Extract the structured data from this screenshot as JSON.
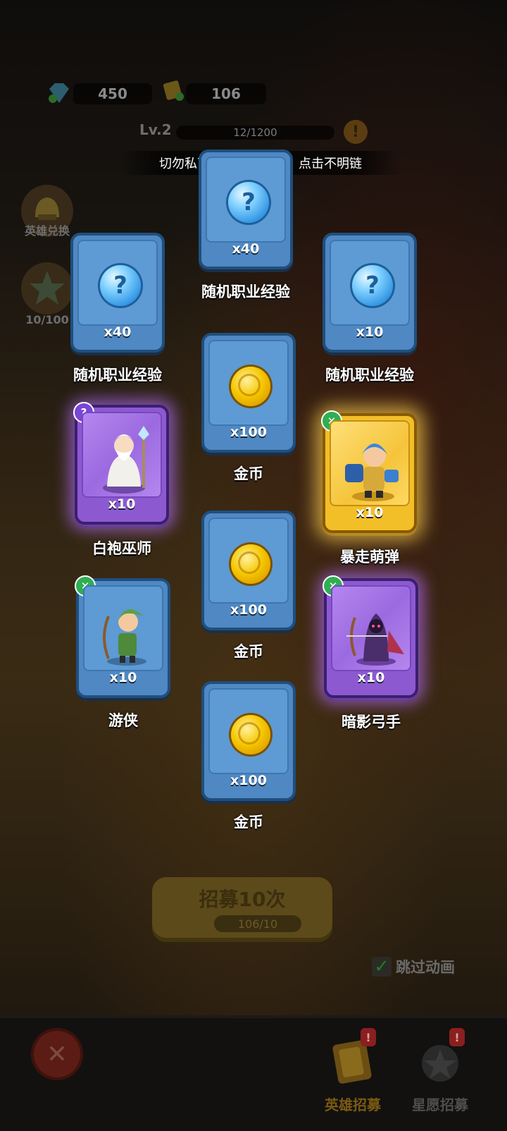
{
  "hud": {
    "gems": "450",
    "tickets": "106",
    "level": "Lv.2",
    "xp": "12/1200",
    "warning_icon": "!"
  },
  "notice": "切勿私下交易买卖账号、点击不明链",
  "side": {
    "hero_exchange": "英雄兑换",
    "star_progress": "10/100"
  },
  "rewards": [
    {
      "qty": "x40",
      "label": "随机职业经验"
    },
    {
      "qty": "x40",
      "label": "随机职业经验"
    },
    {
      "qty": "x10",
      "label": "随机职业经验"
    },
    {
      "qty": "x100",
      "label": "金币"
    },
    {
      "qty": "x10",
      "label": "白袍巫师",
      "badge": "?"
    },
    {
      "qty": "x10",
      "label": "暴走萌弹",
      "badge": "✕"
    },
    {
      "qty": "x100",
      "label": "金币"
    },
    {
      "qty": "x10",
      "label": "游侠",
      "badge": "✕"
    },
    {
      "qty": "x10",
      "label": "暗影弓手",
      "badge": "✕"
    },
    {
      "qty": "x100",
      "label": "金币"
    }
  ],
  "recruit": {
    "button": "招募10次",
    "cost": "106/10"
  },
  "skip_animation": "跳过动画",
  "skip_check": "✓",
  "tabs": {
    "hero_recruit": "英雄招募",
    "star_recruit": "星愿招募"
  },
  "colors": {
    "card_blue": "#4f88c3",
    "card_purple": "#8d59d1",
    "card_gold": "#f3bf29",
    "active_tab": "#e0a21a"
  }
}
